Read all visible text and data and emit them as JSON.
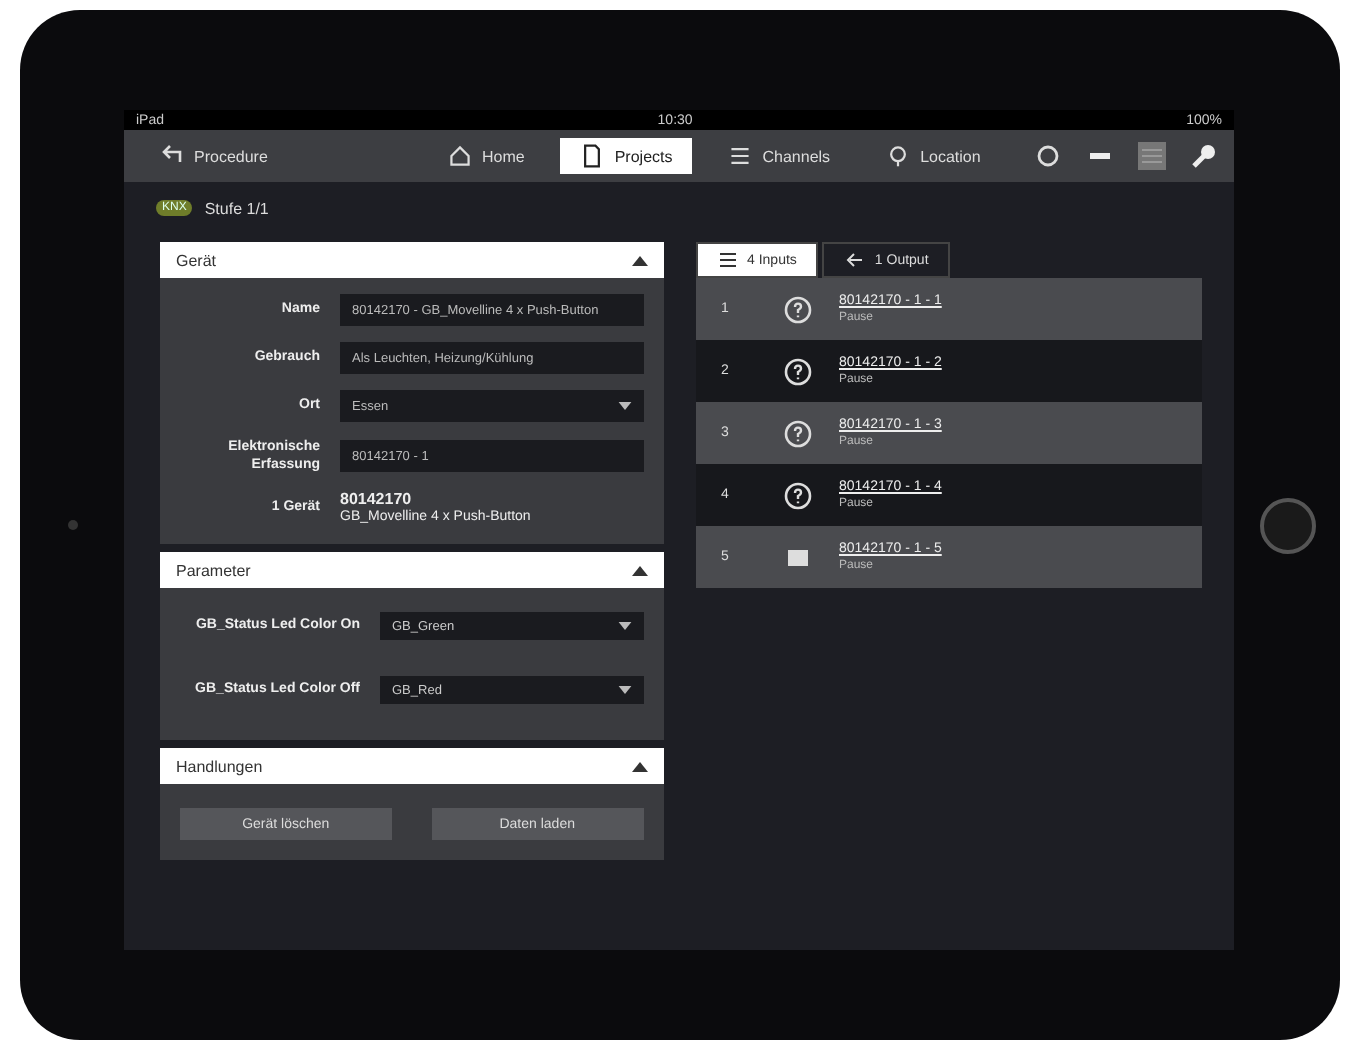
{
  "status_bar": {
    "device": "iPad",
    "time": "10:30",
    "battery": "100%"
  },
  "toolbar": {
    "back": "Procedure",
    "tabs": [
      {
        "label": "Home",
        "selected": false,
        "kind": "home"
      },
      {
        "label": "Projects",
        "selected": true,
        "kind": "doc"
      },
      {
        "label": "Channels",
        "selected": false,
        "kind": "list"
      },
      {
        "label": "Location",
        "selected": false,
        "kind": "pin"
      }
    ]
  },
  "breadcrumb": {
    "badge": "KNX",
    "title": "Stufe 1/1"
  },
  "device_panel": {
    "title": "Gerät",
    "expanded": true,
    "fields": [
      {
        "label": "Name",
        "value": "80142170 - GB_Movelline 4 x Push-Button",
        "kind": "text"
      },
      {
        "label": "Gebrauch",
        "value": "Als Leuchten, Heizung/Kühlung",
        "kind": "text"
      },
      {
        "label": "Ort",
        "value": "Essen",
        "kind": "select"
      },
      {
        "label": "Elektronische Erfassung",
        "value": "80142170 - 1",
        "kind": "text"
      }
    ],
    "count_label": "1 Gerät",
    "device_id": "80142170",
    "device_name": "GB_Movelline 4 x Push-Button"
  },
  "parameter_panel": {
    "title": "Parameter",
    "expanded": true,
    "params": [
      {
        "label": "GB_Status Led Color On",
        "value": "GB_Green"
      },
      {
        "label": "GB_Status Led Color Off",
        "value": "GB_Red"
      }
    ]
  },
  "actions_panel": {
    "title": "Handlungen",
    "expanded": true,
    "buttons": [
      "Gerät löschen",
      "Daten laden"
    ]
  },
  "io_tabs": [
    {
      "label": "4 Inputs",
      "selected": true
    },
    {
      "label": "1 Output",
      "selected": false
    }
  ],
  "channels": [
    {
      "number": "1",
      "kind": "question",
      "link": "80142170 - 1 - 1",
      "sub": "Pause"
    },
    {
      "number": "2",
      "kind": "question",
      "link": "80142170 - 1 - 2",
      "sub": "Pause"
    },
    {
      "number": "3",
      "kind": "question",
      "link": "80142170 - 1 - 3",
      "sub": "Pause"
    },
    {
      "number": "4",
      "kind": "question",
      "link": "80142170 - 1 - 4",
      "sub": "Pause"
    },
    {
      "number": "5",
      "kind": "square",
      "link": "80142170 - 1 - 5",
      "sub": "Pause"
    }
  ]
}
